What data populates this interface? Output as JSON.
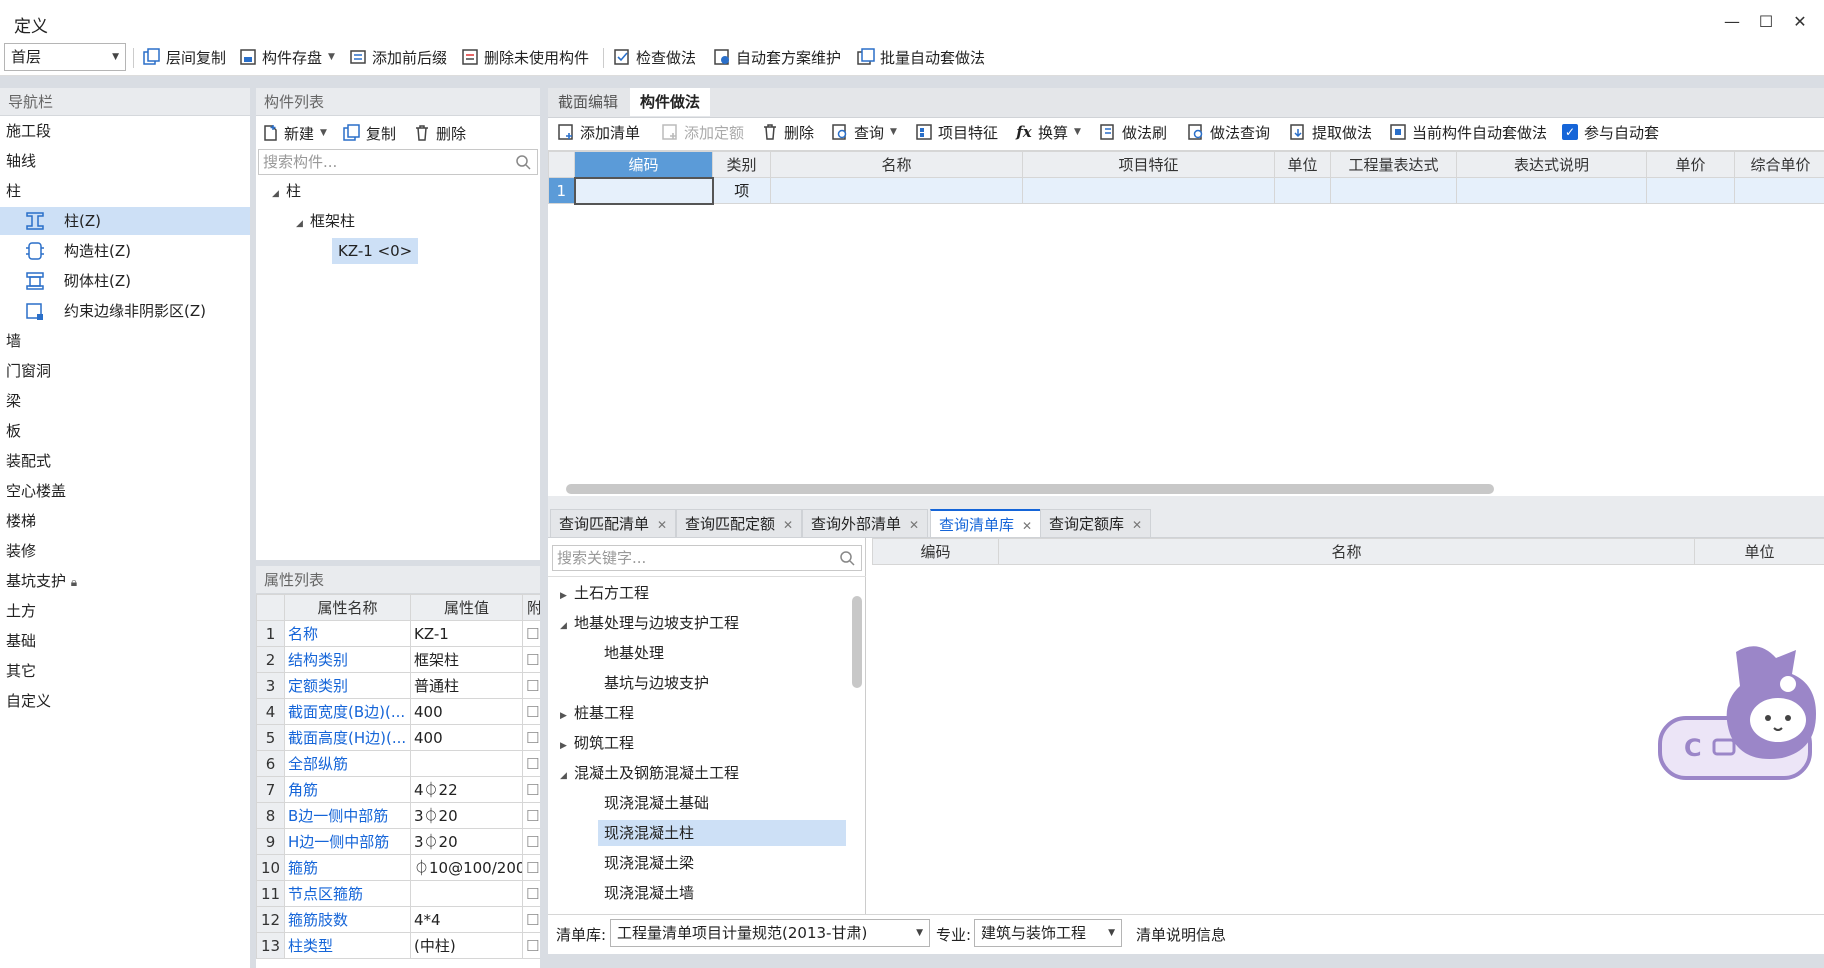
{
  "window": {
    "title": "定义"
  },
  "toolbar": {
    "floor_select": "首层",
    "items": [
      "层间复制",
      "构件存盘",
      "添加前后缀",
      "删除未使用构件",
      "检查做法",
      "自动套方案维护",
      "批量自动套做法"
    ]
  },
  "nav": {
    "title": "导航栏",
    "items": [
      "施工段",
      "轴线",
      "柱",
      "墙",
      "门窗洞",
      "梁",
      "板",
      "装配式",
      "空心楼盖",
      "楼梯",
      "装修",
      "基坑支护",
      "土方",
      "基础",
      "其它",
      "自定义"
    ],
    "subitems": [
      "柱(Z)",
      "构造柱(Z)",
      "砌体柱(Z)",
      "约束边缘非阴影区(Z)"
    ]
  },
  "component_list": {
    "title": "构件列表",
    "buttons": [
      "新建",
      "复制",
      "删除"
    ],
    "search_placeholder": "搜索构件...",
    "tree": {
      "root": "柱",
      "child": "框架柱",
      "leaf": "KZ-1 <0>"
    }
  },
  "property_list": {
    "title": "属性列表",
    "headers": [
      "属性名称",
      "属性值",
      "附"
    ],
    "rows": [
      {
        "n": "1",
        "name": "名称",
        "value": "KZ-1"
      },
      {
        "n": "2",
        "name": "结构类别",
        "value": "框架柱"
      },
      {
        "n": "3",
        "name": "定额类别",
        "value": "普通柱"
      },
      {
        "n": "4",
        "name": "截面宽度(B边)(...",
        "value": "400"
      },
      {
        "n": "5",
        "name": "截面高度(H边)(...",
        "value": "400"
      },
      {
        "n": "6",
        "name": "全部纵筋",
        "value": ""
      },
      {
        "n": "7",
        "name": "角筋",
        "value": "4⏀22"
      },
      {
        "n": "8",
        "name": "B边一侧中部筋",
        "value": "3⏀20"
      },
      {
        "n": "9",
        "name": "H边一侧中部筋",
        "value": "3⏀20"
      },
      {
        "n": "10",
        "name": "箍筋",
        "value": "⏀10@100/200"
      },
      {
        "n": "11",
        "name": "节点区箍筋",
        "value": ""
      },
      {
        "n": "12",
        "name": "箍筋肢数",
        "value": "4*4"
      },
      {
        "n": "13",
        "name": "柱类型",
        "value": "(中柱)"
      }
    ]
  },
  "main": {
    "tabs": [
      "截面编辑",
      "构件做法"
    ],
    "buttons": [
      "添加清单",
      "添加定额",
      "删除",
      "查询",
      "项目特征",
      "换算",
      "做法刷",
      "做法查询",
      "提取做法",
      "当前构件自动套做法"
    ],
    "auto_check_label": "参与自动套",
    "headers": [
      "编码",
      "类别",
      "名称",
      "项目特征",
      "单位",
      "工程量表达式",
      "表达式说明",
      "单价",
      "综合单价"
    ],
    "row": {
      "n": "1",
      "type": "项"
    }
  },
  "bottom": {
    "tabs": [
      "查询匹配清单",
      "查询匹配定额",
      "查询外部清单",
      "查询清单库",
      "查询定额库"
    ],
    "search_placeholder": "搜索关键字...",
    "tree": [
      {
        "label": "土石方工程",
        "level": 0,
        "state": "collapsed"
      },
      {
        "label": "地基处理与边坡支护工程",
        "level": 0,
        "state": "expanded"
      },
      {
        "label": "地基处理",
        "level": 1
      },
      {
        "label": "基坑与边坡支护",
        "level": 1
      },
      {
        "label": "桩基工程",
        "level": 0,
        "state": "collapsed"
      },
      {
        "label": "砌筑工程",
        "level": 0,
        "state": "collapsed"
      },
      {
        "label": "混凝土及钢筋混凝土工程",
        "level": 0,
        "state": "expanded"
      },
      {
        "label": "现浇混凝土基础",
        "level": 1
      },
      {
        "label": "现浇混凝土柱",
        "level": 1,
        "selected": true
      },
      {
        "label": "现浇混凝土梁",
        "level": 1
      },
      {
        "label": "现浇混凝土墙",
        "level": 1
      }
    ],
    "headers": [
      "编码",
      "名称",
      "单位"
    ],
    "footer": {
      "lib_label": "清单库:",
      "lib_value": "工程量清单项目计量规范(2013-甘肃)",
      "major_label": "专业:",
      "major_value": "建筑与装饰工程",
      "info": "清单说明信息"
    }
  },
  "colors": {
    "accent": "#1565d8",
    "selection": "#cde0f6",
    "mascot": "#9b86c8"
  }
}
